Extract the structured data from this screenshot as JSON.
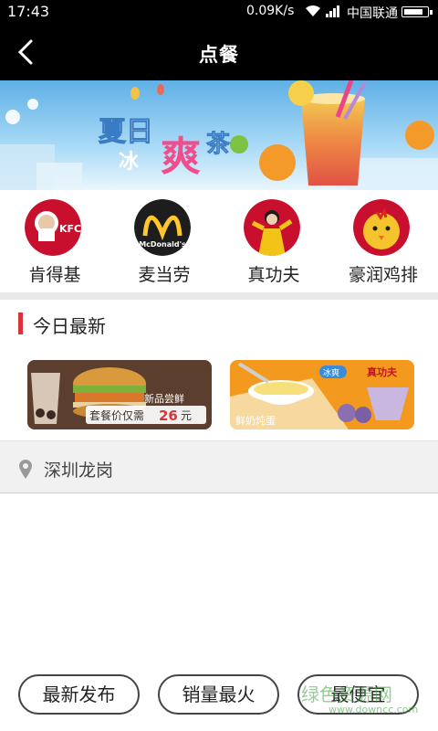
{
  "status_bar": {
    "time": "17:43",
    "speed": "0.09K/s",
    "carrier": "中国联通",
    "battery_level": 0.85
  },
  "header": {
    "title": "点餐"
  },
  "banner": {
    "headline_1": "夏日",
    "headline_2": "冰",
    "headline_3": "爽",
    "headline_4": "茶"
  },
  "brands": [
    {
      "label": "肯得基",
      "logo_text": "KFC"
    },
    {
      "label": "麦当劳",
      "logo_text": "McDonald's"
    },
    {
      "label": "真功夫"
    },
    {
      "label": "豪润鸡排"
    }
  ],
  "today": {
    "title": "今日最新",
    "promo_left": {
      "tag": "新品尝鲜",
      "price_text": "套餐价仅需",
      "price": "26",
      "unit": "元"
    },
    "promo_right": {
      "brand": "真功夫",
      "caption": "鲜奶炖蛋",
      "badge": "冰爽"
    }
  },
  "location": {
    "text": "深圳龙岗"
  },
  "sort_buttons": [
    {
      "label": "最新发布"
    },
    {
      "label": "销量最火"
    },
    {
      "label": "最便宜"
    }
  ],
  "watermark": {
    "text": "绿色资源网",
    "url": "www.downcc.com"
  },
  "colors": {
    "accent_red": "#d9343a",
    "header_bg": "#000000"
  }
}
